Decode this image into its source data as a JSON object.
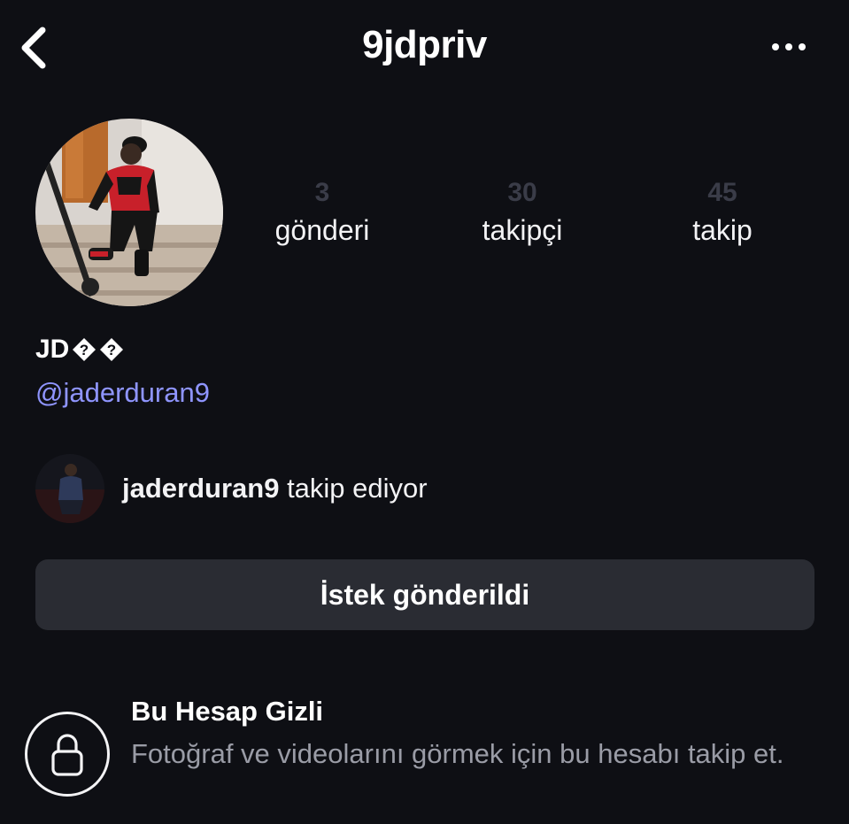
{
  "header": {
    "title": "9jdpriv",
    "back_icon": "chevron-left-icon",
    "more_icon": "ellipsis-icon"
  },
  "profile": {
    "avatar": "profile-photo",
    "stats": [
      {
        "value": "3",
        "label": "gönderi"
      },
      {
        "value": "30",
        "label": "takipçi"
      },
      {
        "value": "45",
        "label": "takip"
      }
    ],
    "display_name": "JD",
    "display_name_glyphs": [
      "�",
      "�"
    ],
    "handle": "@jaderduran9"
  },
  "mutual": {
    "username": "jaderduran9",
    "text": " takip ediyor"
  },
  "request_button": {
    "label": "İstek gönderildi"
  },
  "private_notice": {
    "icon": "lock-icon",
    "title": "Bu Hesap Gizli",
    "description": "Fotoğraf ve videolarını görmek için bu hesabı takip et."
  },
  "colors": {
    "background": "#0e0f14",
    "link": "#8f95ff",
    "button": "#2a2c33",
    "muted": "#9a9ca6",
    "stat_value": "#3a3c48"
  }
}
